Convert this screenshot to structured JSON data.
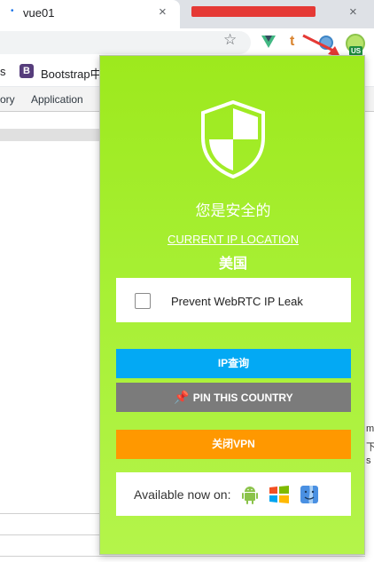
{
  "browser": {
    "tabs": [
      {
        "title": "vue01",
        "close": "×"
      },
      {
        "title": "",
        "close": "×"
      }
    ],
    "toolbar": {
      "extension_badge": "US"
    },
    "bookmarks": [
      {
        "label": "s"
      },
      {
        "icon_letter": "B",
        "label": "Bootstrap中"
      }
    ],
    "devtools_tabs": [
      {
        "label": "ory"
      },
      {
        "label": "Application"
      }
    ],
    "side_chars": [
      "m",
      "下",
      "s"
    ]
  },
  "popup": {
    "status": "您是安全的",
    "location_link": "CURRENT IP LOCATION",
    "country": "美国",
    "webrtc_label": "Prevent WebRTC IP Leak",
    "webrtc_checked": false,
    "ip_button": "IP查询",
    "pin_button": "PIN THIS COUNTRY",
    "vpn_button": "关闭VPN",
    "available_label": "Available now on:",
    "platform_icons": [
      "android-icon",
      "windows-icon",
      "finder-icon"
    ],
    "colors": {
      "background": "#a8f036",
      "ip_button": "#03a9f4",
      "pin_button": "#7b7b7b",
      "vpn_button": "#ff9800"
    }
  }
}
